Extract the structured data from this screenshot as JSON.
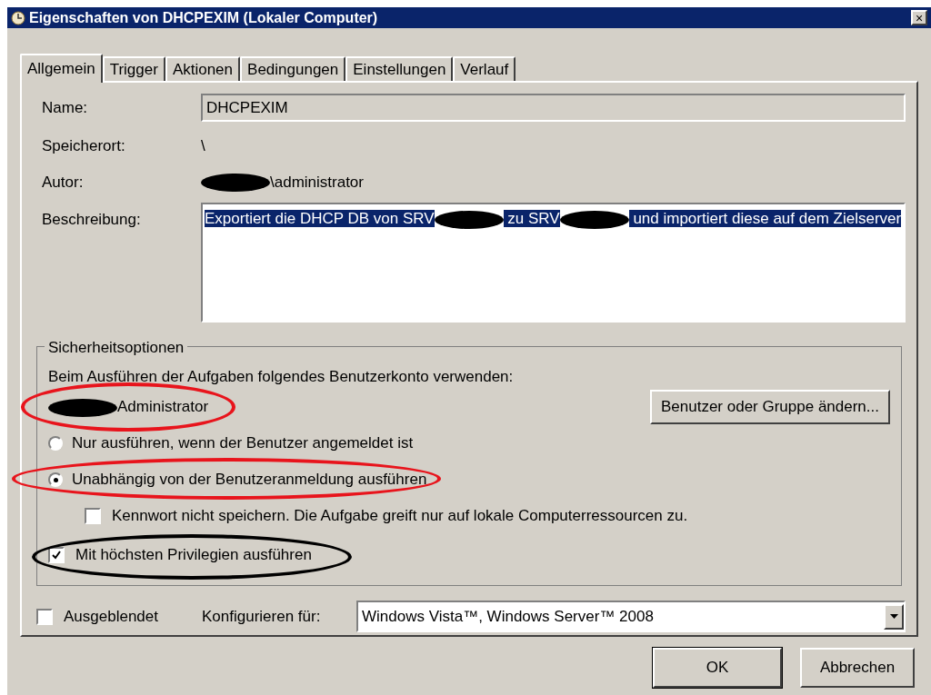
{
  "window": {
    "title": "Eigenschaften von DHCPEXIM (Lokaler Computer)",
    "close": "×"
  },
  "tabs": [
    {
      "label": "Allgemein",
      "selected": true
    },
    {
      "label": "Trigger",
      "selected": false
    },
    {
      "label": "Aktionen",
      "selected": false
    },
    {
      "label": "Bedingungen",
      "selected": false
    },
    {
      "label": "Einstellungen",
      "selected": false
    },
    {
      "label": "Verlauf",
      "selected": false
    }
  ],
  "general": {
    "name": {
      "label": "Name:",
      "value": "DHCPEXIM"
    },
    "location": {
      "label": "Speicherort:",
      "value": "\\"
    },
    "author": {
      "label": "Autor:",
      "parts": [
        {
          "kind": "redaction"
        },
        {
          "kind": "text",
          "text": "\\administrator"
        }
      ]
    },
    "description": {
      "label": "Beschreibung:",
      "parts": [
        {
          "kind": "text",
          "text": "Exportiert die DHCP DB von SRV"
        },
        {
          "kind": "redaction"
        },
        {
          "kind": "text",
          "text": " zu SRV"
        },
        {
          "kind": "redaction"
        },
        {
          "kind": "text",
          "text": " und importiert diese auf dem Zielserver"
        }
      ]
    }
  },
  "security": {
    "title": "Sicherheitsoptionen",
    "account_prompt": "Beim Ausführen der Aufgaben folgendes Benutzerkonto verwenden:",
    "account": {
      "parts": [
        {
          "kind": "redaction"
        },
        {
          "kind": "text",
          "text": "Administrator"
        }
      ],
      "color": "#e8141c"
    },
    "change_button": "Benutzer oder Gruppe ändern...",
    "options": [
      {
        "label": "Nur ausführen, wenn der Benutzer angemeldet ist",
        "selected": false
      },
      {
        "label": "Unabhängig von der Benutzeranmeldung ausführen",
        "selected": true,
        "color": "#e8141c"
      }
    ],
    "no_password": {
      "label": "Kennwort nicht speichern. Die Aufgabe greift nur auf lokale Computerressourcen zu.",
      "checked": false
    },
    "highest_privileges": {
      "label": "Mit höchsten Privilegien ausführen",
      "checked": true,
      "color": "#000000"
    }
  },
  "hidden": {
    "label": "Ausgeblendet",
    "checked": false
  },
  "configure": {
    "label": "Konfigurieren für:",
    "value": "Windows Vista™, Windows Server™ 2008"
  },
  "buttons": [
    {
      "label": "OK",
      "default": true
    },
    {
      "label": "Abbrechen",
      "default": false
    }
  ]
}
